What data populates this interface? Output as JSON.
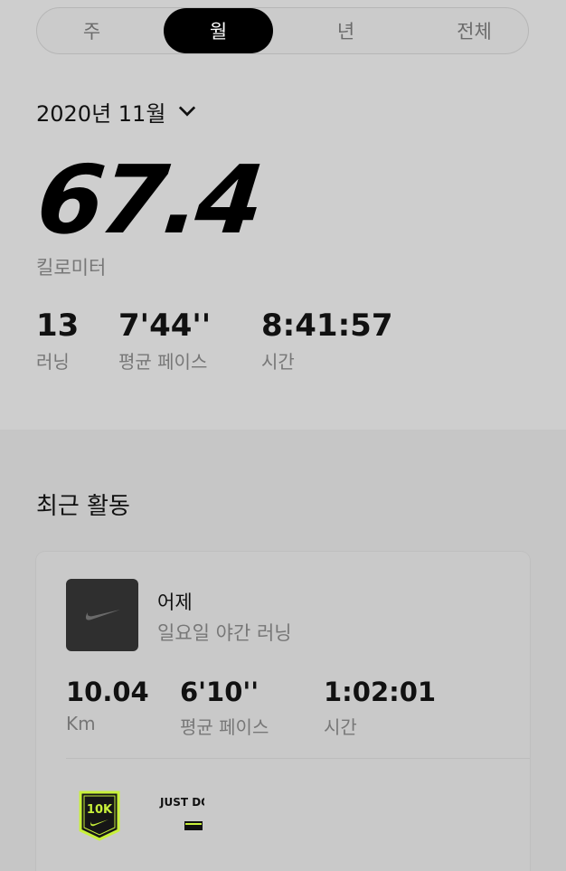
{
  "tabs": [
    "주",
    "월",
    "년",
    "전체"
  ],
  "active_tab_index": 1,
  "period": {
    "label": "2020년 11월"
  },
  "summary": {
    "distance_value": "67.4",
    "distance_unit": "킬로미터",
    "stats": [
      {
        "value": "13",
        "label": "러닝"
      },
      {
        "value": "7'44''",
        "label": "평균 페이스"
      },
      {
        "value": "8:41:57",
        "label": "시간"
      }
    ]
  },
  "recent": {
    "title": "최근 활동",
    "activity": {
      "when": "어제",
      "name": "일요일 야간 러닝",
      "stats": [
        {
          "value": "10.04",
          "label": "Km"
        },
        {
          "value": "6'10''",
          "label": "평균 페이스"
        },
        {
          "value": "1:02:01",
          "label": "시간"
        }
      ],
      "badges": [
        {
          "text": "10K",
          "color": "#c8f03a"
        },
        {
          "text": "JUST DO IT.",
          "color": "#111111"
        }
      ]
    }
  },
  "colors": {
    "accent": "#000000",
    "badge_green": "#c8f03a"
  }
}
